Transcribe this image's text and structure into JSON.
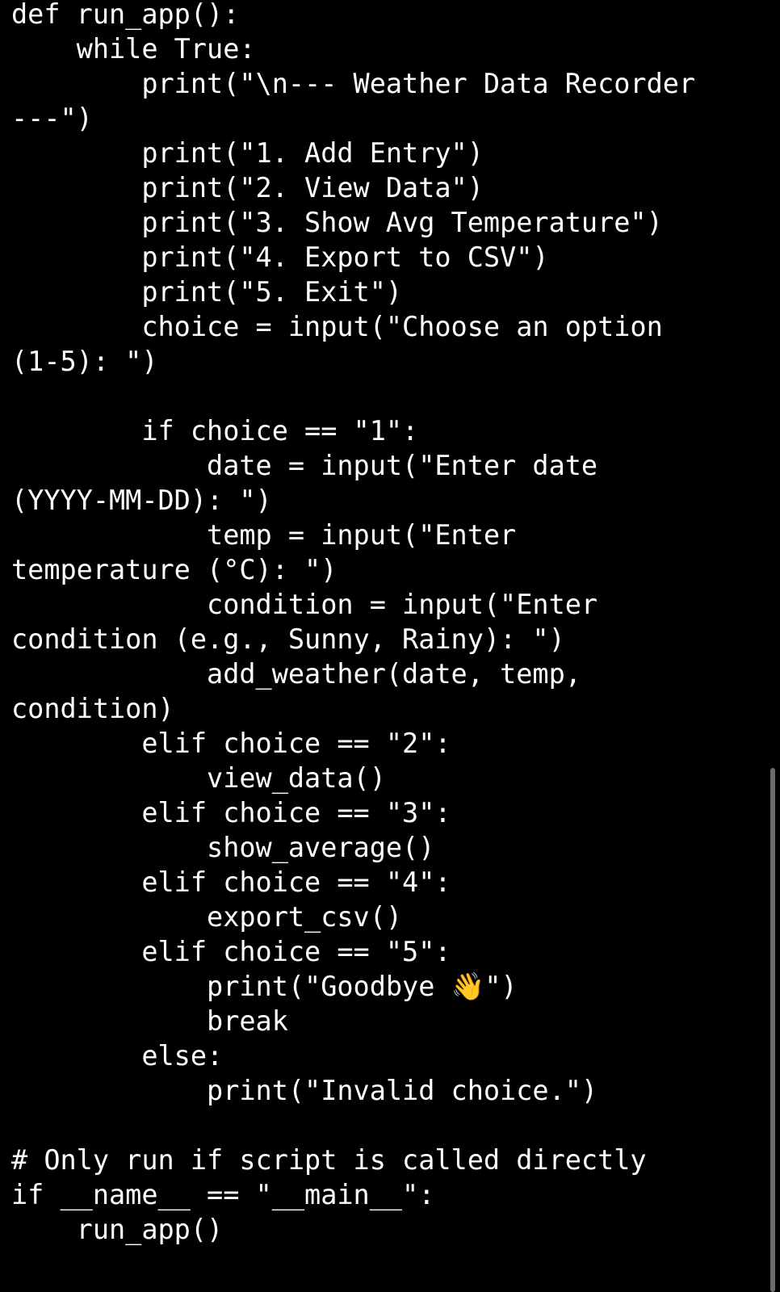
{
  "editor": {
    "lines": [
      "def run_app():",
      "    while True:",
      "        print(\"\\n--- Weather Data Recorder",
      "---\")",
      "        print(\"1. Add Entry\")",
      "        print(\"2. View Data\")",
      "        print(\"3. Show Avg Temperature\")",
      "        print(\"4. Export to CSV\")",
      "        print(\"5. Exit\")",
      "        choice = input(\"Choose an option",
      "(1-5): \")",
      "",
      "        if choice == \"1\":",
      "            date = input(\"Enter date",
      "(YYYY-MM-DD): \")",
      "            temp = input(\"Enter",
      "temperature (°C): \")",
      "            condition = input(\"Enter",
      "condition (e.g., Sunny, Rainy): \")",
      "            add_weather(date, temp,",
      "condition)",
      "        elif choice == \"2\":",
      "            view_data()",
      "        elif choice == \"3\":",
      "            show_average()",
      "        elif choice == \"4\":",
      "            export_csv()",
      "        elif choice == \"5\":",
      "            print(\"Goodbye 👋\")",
      "            break",
      "        else:",
      "            print(\"Invalid choice.\")",
      "",
      "# Only run if script is called directly",
      "if __name__ == \"__main__\":",
      "    run_app()"
    ]
  },
  "colors": {
    "background": "#000000",
    "text": "#ffffff",
    "scrollbar": "#6b6b6b"
  }
}
